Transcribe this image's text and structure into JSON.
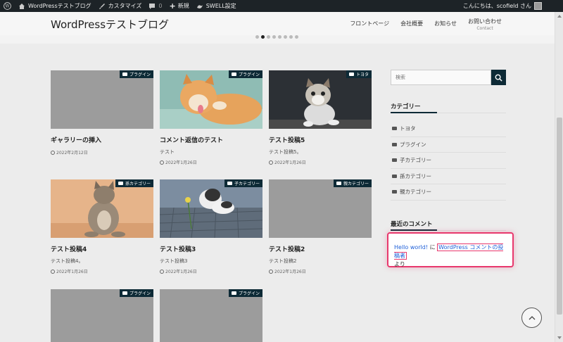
{
  "adminbar": {
    "site_name": "WordPressテストブログ",
    "customize": "カスタマイズ",
    "comments_count": "0",
    "new_label": "新規",
    "swell_settings": "SWELL設定",
    "greeting": "こんにちは、scofield さん"
  },
  "header": {
    "site_title": "WordPressテストブログ",
    "nav": [
      {
        "label": "フロントページ",
        "sub": ""
      },
      {
        "label": "会社概要",
        "sub": ""
      },
      {
        "label": "お知らせ",
        "sub": ""
      },
      {
        "label": "お問い合わせ",
        "sub": "Contact"
      }
    ]
  },
  "posts": [
    {
      "title": "ギャラリーの挿入",
      "excerpt": "",
      "date": "2022年2月12日",
      "category": "プラグイン",
      "image": "gray"
    },
    {
      "title": "コメント返信のテスト",
      "excerpt": "テスト",
      "date": "2022年1月26日",
      "category": "プラグイン",
      "image": "cat-licking"
    },
    {
      "title": "テスト投稿5",
      "excerpt": "テスト投稿5。",
      "date": "2022年1月26日",
      "category": "トヨタ",
      "image": "kitten-dark"
    },
    {
      "title": "テスト投稿4",
      "excerpt": "テスト投稿4。",
      "date": "2022年1月26日",
      "category": "孫カテゴリー",
      "image": "cat-sitting"
    },
    {
      "title": "テスト投稿3",
      "excerpt": "テスト投稿3",
      "date": "2022年1月26日",
      "category": "子カテゴリー",
      "image": "kitten-flower"
    },
    {
      "title": "テスト投稿2",
      "excerpt": "テスト投稿2",
      "date": "2022年1月26日",
      "category": "親カテゴリー",
      "image": "gray"
    },
    {
      "title": "",
      "excerpt": "",
      "date": "",
      "category": "プラグイン",
      "image": "gray"
    },
    {
      "title": "",
      "excerpt": "",
      "date": "",
      "category": "プラグイン",
      "image": "gray"
    }
  ],
  "sidebar": {
    "search_placeholder": "検索",
    "category_title": "カテゴリー",
    "categories": [
      "トヨタ",
      "プラグイン",
      "子カテゴリー",
      "孫カテゴリー",
      "親カテゴリー"
    ],
    "recent_comments_title": "最近のコメント",
    "comment": {
      "post_link": "Hello world!",
      "connector": "に",
      "author_link": "WordPress コメントの投稿者",
      "suffix": "より"
    }
  },
  "colors": {
    "accent": "#0d2a36",
    "highlight": "#e8386d",
    "link": "#1e5fd8"
  }
}
